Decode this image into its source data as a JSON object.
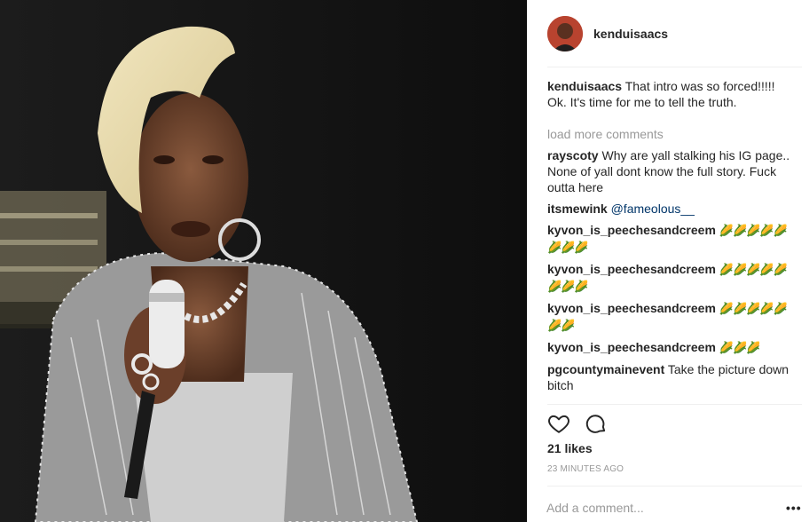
{
  "post": {
    "username": "kenduisaacs",
    "likes": "21 likes",
    "timestamp": "23 MINUTES AGO",
    "load_more": "load more comments",
    "add_comment_placeholder": "Add a comment...",
    "more_label": "•••"
  },
  "caption": {
    "user": "kenduisaacs",
    "text": " That intro was so forced!!!!! Ok. It's time for me to tell the truth."
  },
  "comments": [
    {
      "user": "rayscoty",
      "text": " Why are yall stalking his IG page.. None of yall dont know the full story. Fuck outta here"
    },
    {
      "user": "itsmewink",
      "text": " ",
      "mention": "@fameolous__"
    },
    {
      "user": "kyvon_is_peechesandcreem",
      "text": " ",
      "emoji": "🌽🌽🌽🌽🌽🌽🌽🌽"
    },
    {
      "user": "kyvon_is_peechesandcreem",
      "text": " ",
      "emoji": "🌽🌽🌽🌽🌽🌽🌽🌽"
    },
    {
      "user": "kyvon_is_peechesandcreem",
      "text": " ",
      "emoji": "🌽🌽🌽🌽🌽🌽🌽"
    },
    {
      "user": "kyvon_is_peechesandcreem",
      "text": " ",
      "emoji": "🌽🌽🌽"
    },
    {
      "user": "pgcountymainevent",
      "text": " Take the picture down bitch"
    }
  ],
  "icons": {
    "like": "heart-icon",
    "comment": "speech-bubble-icon"
  },
  "colors": {
    "text": "#262626",
    "muted": "#999999",
    "mention": "#003569",
    "border": "#efefef"
  }
}
